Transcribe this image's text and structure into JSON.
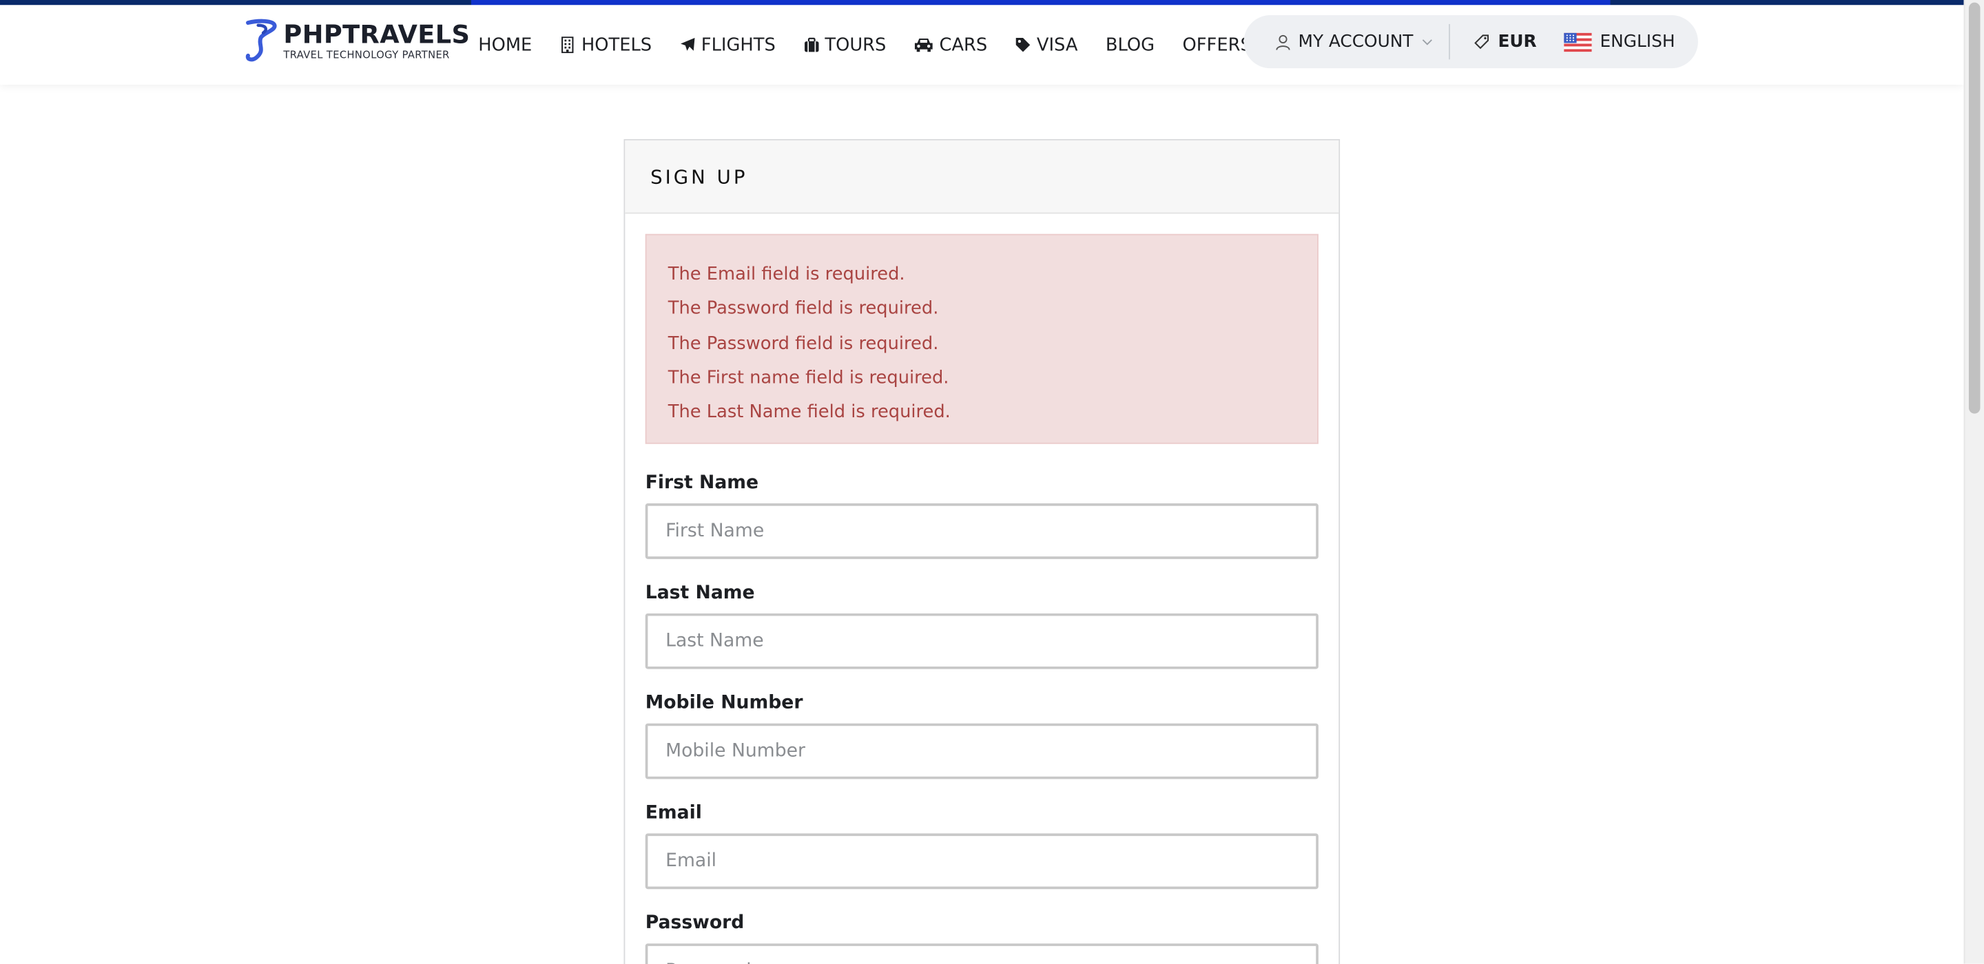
{
  "brand": {
    "name": "PHPTRAVELS",
    "tagline": "TRAVEL TECHNOLOGY PARTNER",
    "accent": "#3a5bd9"
  },
  "nav": {
    "items": [
      {
        "label": "HOME",
        "icon": ""
      },
      {
        "label": "HOTELS",
        "icon": "building-icon"
      },
      {
        "label": "FLIGHTS",
        "icon": "plane-icon"
      },
      {
        "label": "TOURS",
        "icon": "suitcase-icon"
      },
      {
        "label": "CARS",
        "icon": "car-icon"
      },
      {
        "label": "VISA",
        "icon": "tag-icon"
      },
      {
        "label": "BLOG",
        "icon": ""
      },
      {
        "label": "OFFERS",
        "icon": ""
      }
    ]
  },
  "account": {
    "label": "MY ACCOUNT",
    "icon": "user-icon"
  },
  "currency": {
    "label": "EUR",
    "icon": "ticket-icon"
  },
  "language": {
    "label": "ENGLISH",
    "icon": "us-flag-icon"
  },
  "signup": {
    "title": "SIGN UP",
    "errors": [
      "The Email field is required.",
      "The Password field is required.",
      "The Password field is required.",
      "The First name field is required.",
      "The Last Name field is required."
    ],
    "fields": [
      {
        "label": "First Name",
        "placeholder": "First Name",
        "value": ""
      },
      {
        "label": "Last Name",
        "placeholder": "Last Name",
        "value": ""
      },
      {
        "label": "Mobile Number",
        "placeholder": "Mobile Number",
        "value": ""
      },
      {
        "label": "Email",
        "placeholder": "Email",
        "value": ""
      },
      {
        "label": "Password",
        "placeholder": "Password",
        "value": ""
      }
    ]
  },
  "colors": {
    "alert_bg": "#f2dede",
    "alert_text": "#a94442",
    "topbar": "#1133cc"
  }
}
